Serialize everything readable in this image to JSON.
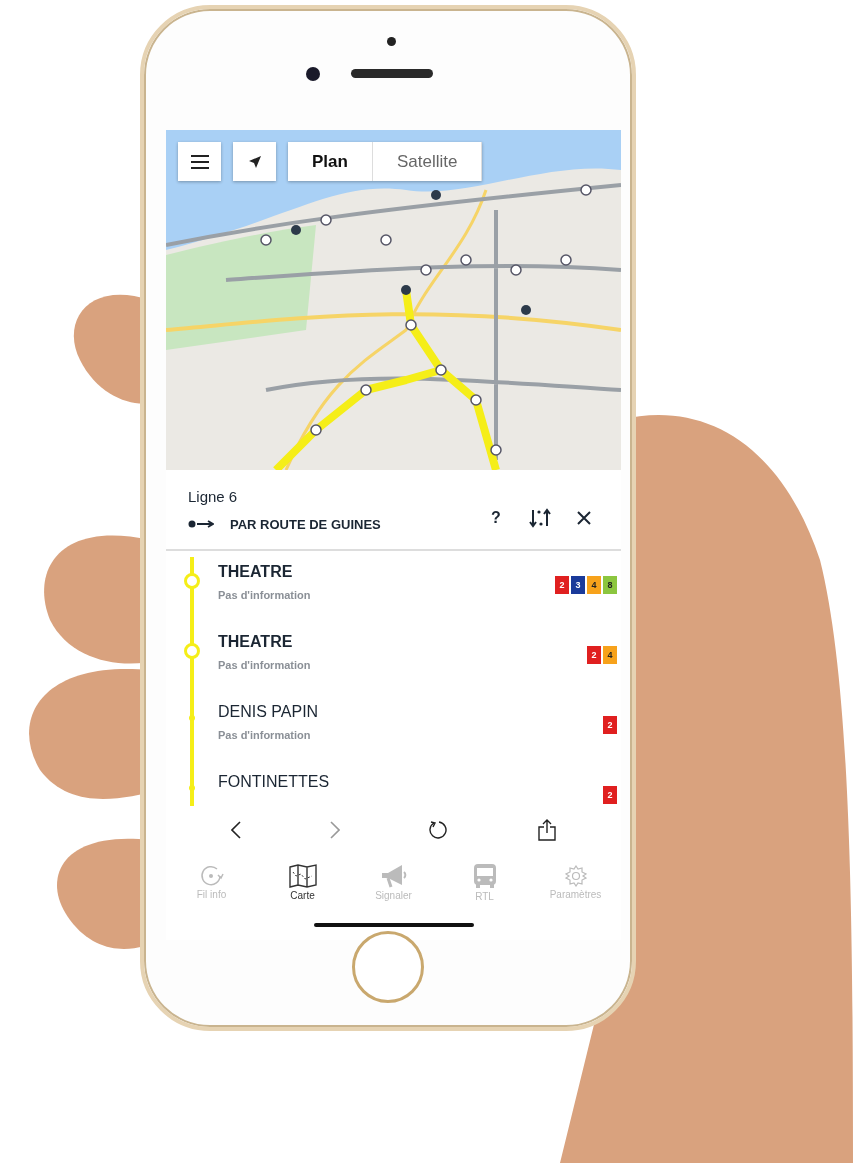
{
  "map_controls": {
    "view_modes": [
      {
        "label": "Plan",
        "selected": true
      },
      {
        "label": "Satellite",
        "selected": false
      }
    ]
  },
  "line_panel": {
    "title": "Ligne 6",
    "direction": "PAR ROUTE DE GUINES",
    "help": "?"
  },
  "stops": [
    {
      "name": "THEATRE",
      "info": "Pas d'information",
      "kind": "major",
      "lines": [
        {
          "label": "2",
          "color": "#e02020"
        },
        {
          "label": "3",
          "color": "#1a3a9a"
        },
        {
          "label": "4",
          "color": "#f7a21b"
        },
        {
          "label": "8",
          "color": "#8cc63f"
        }
      ]
    },
    {
      "name": "THEATRE",
      "info": "Pas d'information",
      "kind": "major",
      "lines": [
        {
          "label": "2",
          "color": "#e02020"
        },
        {
          "label": "4",
          "color": "#f7a21b"
        }
      ]
    },
    {
      "name": "DENIS PAPIN",
      "info": "Pas d'information",
      "kind": "minor",
      "lines": [
        {
          "label": "2",
          "color": "#e02020"
        }
      ]
    },
    {
      "name": "FONTINETTES",
      "kind": "minor",
      "lines": [
        {
          "label": "2",
          "color": "#e02020"
        }
      ]
    }
  ],
  "browser_toolbar": {
    "back_disabled": false,
    "forward_disabled": true
  },
  "tabs": [
    {
      "label": "Fil info",
      "selected": false
    },
    {
      "label": "Carte",
      "selected": true
    },
    {
      "label": "Signaler",
      "selected": false
    },
    {
      "label": "RTL",
      "selected": false
    },
    {
      "label": "Paramètres",
      "selected": false
    }
  ]
}
